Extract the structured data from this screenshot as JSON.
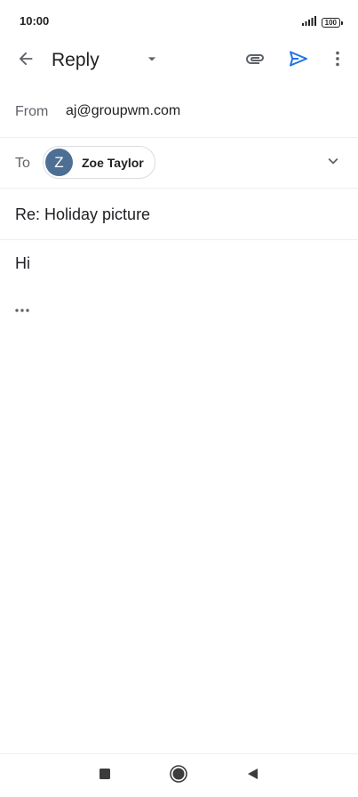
{
  "status_bar": {
    "time": "10:00",
    "battery": "100"
  },
  "app_bar": {
    "title": "Reply"
  },
  "compose": {
    "from_label": "From",
    "from_value": "aj@groupwm.com",
    "to_label": "To",
    "recipient": {
      "initial": "Z",
      "name": "Zoe Taylor",
      "avatar_color": "#4d6f93"
    },
    "subject": "Re: Holiday picture",
    "body": "Hi"
  },
  "colors": {
    "send_accent": "#1a73e8",
    "icon_gray": "#5f6368"
  },
  "icons": {
    "back": "arrow-left-icon",
    "dropdown": "caret-down-icon",
    "attach": "paperclip-icon",
    "send": "send-icon",
    "more": "more-vert-icon",
    "expand": "chevron-down-icon",
    "quote": "more-horiz-icon"
  }
}
